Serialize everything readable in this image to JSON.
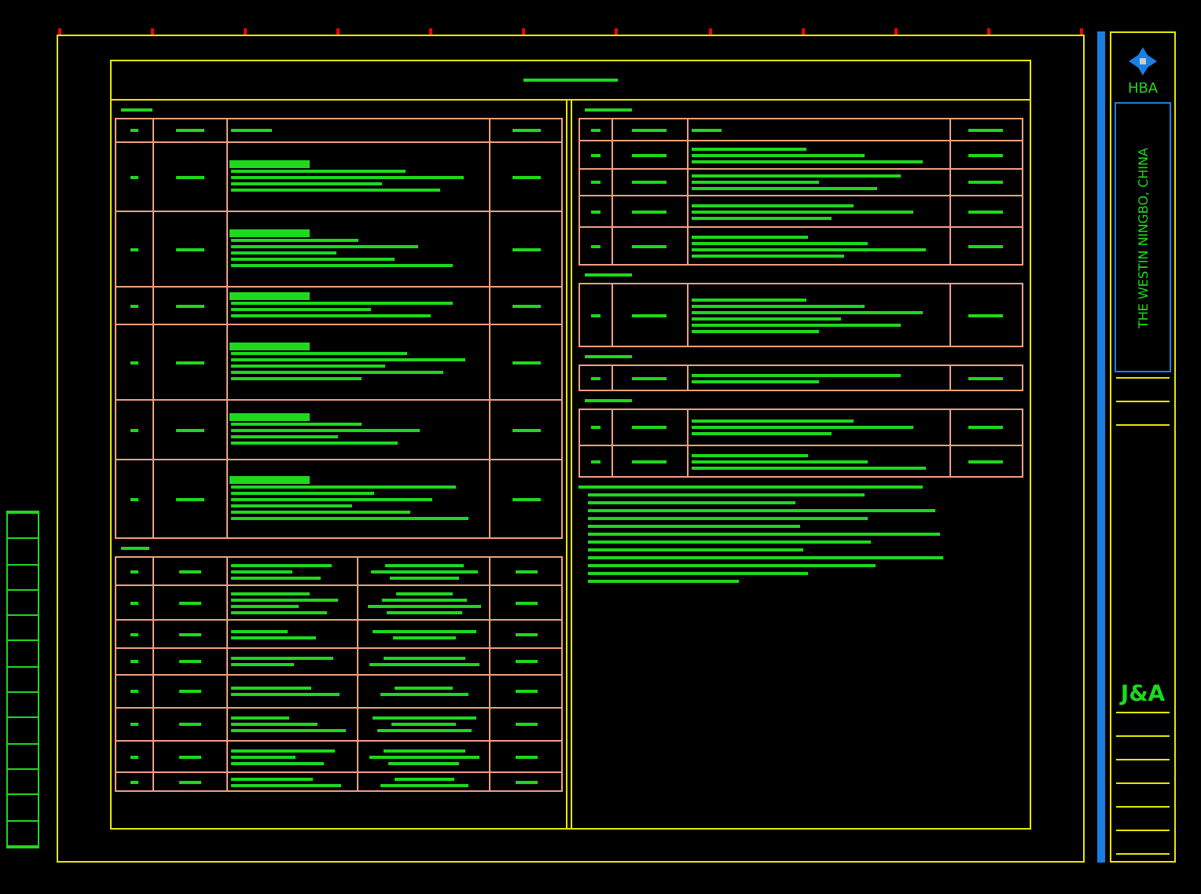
{
  "title_block": {
    "logo": "HBA",
    "project": "THE WESTIN NINGBO, CHINA",
    "firm_logo": "J&A"
  }
}
